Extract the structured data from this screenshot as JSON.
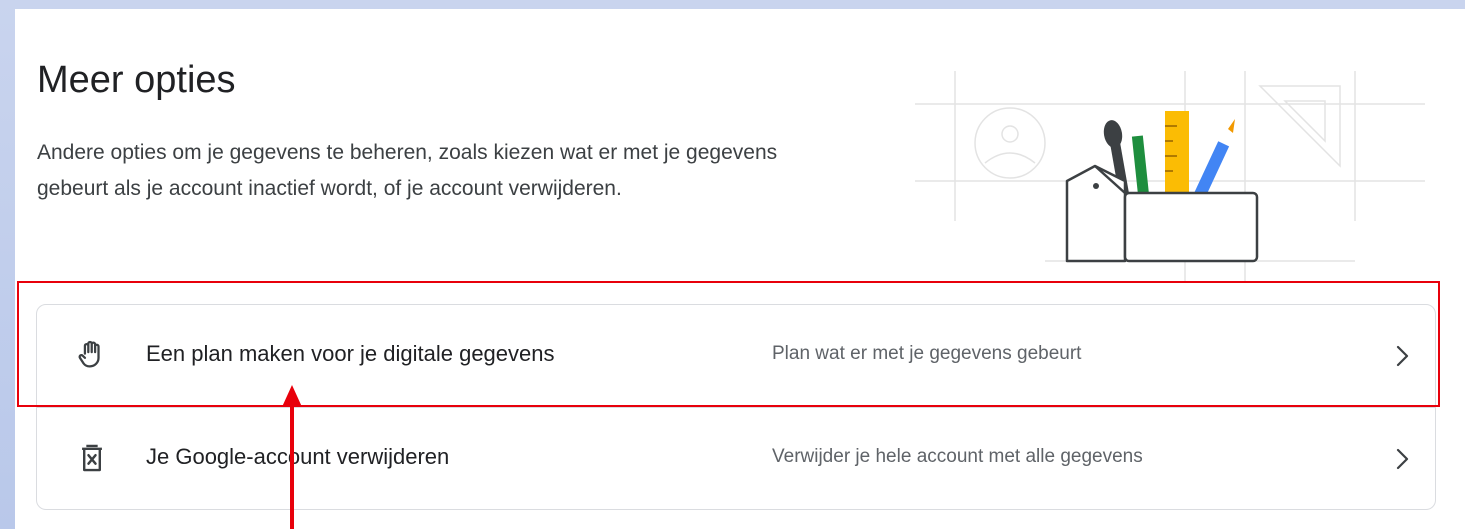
{
  "section": {
    "title": "Meer opties",
    "description": "Andere opties om je gegevens te beheren, zoals kiezen wat er met je gegevens gebeurt als je account inactief wordt, of je account verwijderen."
  },
  "options": [
    {
      "title": "Een plan maken voor je digitale gegevens",
      "subtitle": "Plan wat er met je gegevens gebeurt",
      "icon": "hand-icon"
    },
    {
      "title": "Je Google-account verwijderen",
      "subtitle": "Verwijder je hele account met alle gegevens",
      "icon": "delete-bin-icon"
    }
  ],
  "illustration": "toolbox-illustration",
  "annotations": {
    "highlight_color": "#e8000b",
    "arrow_color": "#e8000b"
  },
  "colors": {
    "background": "#c9d4ee",
    "text_primary": "#202124",
    "text_secondary": "#5f6368"
  }
}
